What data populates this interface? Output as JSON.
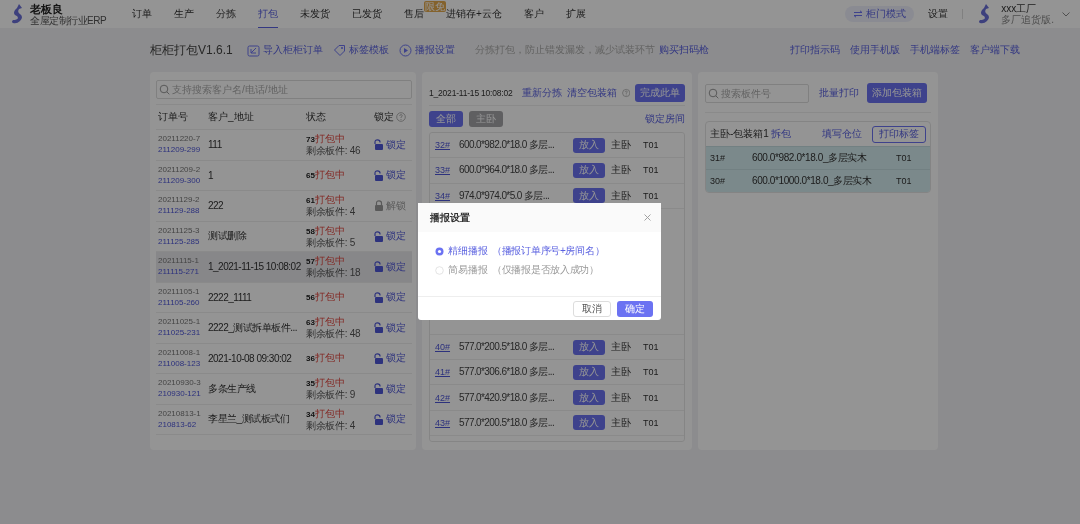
{
  "nav": {
    "logo": {
      "name": "老板良",
      "tagline": "全屋定制行业ERP"
    },
    "items": [
      {
        "label": "订单",
        "selected": false
      },
      {
        "label": "生产",
        "selected": false
      },
      {
        "label": "分拣",
        "selected": false
      },
      {
        "label": "打包",
        "selected": true
      },
      {
        "label": "未发货",
        "selected": false
      },
      {
        "label": "已发货",
        "selected": false
      },
      {
        "label": "售后",
        "selected": false,
        "badge": "限免"
      },
      {
        "label": "进销存+云仓",
        "selected": false
      },
      {
        "label": "客户",
        "selected": false
      },
      {
        "label": "扩展",
        "selected": false
      }
    ],
    "mode_button": "柜门模式",
    "settings": "设置",
    "user": {
      "name": "xxx工厂",
      "plan": "多厂追货版."
    }
  },
  "toolbar": {
    "title": "柜柜打包V1.6.1",
    "actions": [
      {
        "label": "导入柜柜订单",
        "kind": "import"
      },
      {
        "label": "标签模板",
        "kind": "tag"
      },
      {
        "label": "播报设置",
        "kind": "play"
      }
    ],
    "hint": "分拣打包，防止错发漏发，减少试装环节",
    "hint_link": "购买扫码枪",
    "links": [
      "打印指示码",
      "使用手机版",
      "手机端标签",
      "客户端下载"
    ]
  },
  "orders": {
    "search_placeholder": "支持搜索客户名/电话/地址",
    "columns": [
      {
        "label": "订单号",
        "help": false
      },
      {
        "label": "客户_地址",
        "help": false
      },
      {
        "label": "状态",
        "help": false
      },
      {
        "label": "锁定",
        "help": true
      }
    ],
    "rows": [
      {
        "order_no": "20211220-7",
        "batch_no": "211209-299",
        "customer": "111",
        "count": "73",
        "status": "打包中",
        "remaining": "剩余板件: 46",
        "lock_label": "锁定",
        "locked": false,
        "selected": false
      },
      {
        "order_no": "20211209-2",
        "batch_no": "211209-300",
        "customer": "1",
        "count": "65",
        "status": "打包中",
        "lock_label": "锁定",
        "locked": false,
        "selected": false
      },
      {
        "order_no": "20211129-2",
        "batch_no": "211129-288",
        "customer": "222",
        "count": "61",
        "status": "打包中",
        "remaining": "剩余板件: 4",
        "lock_label": "解锁",
        "locked": true,
        "selected": false
      },
      {
        "order_no": "20211125-3",
        "batch_no": "211125-285",
        "customer": "测试删除",
        "count": "58",
        "status": "打包中",
        "remaining": "剩余板件: 5",
        "lock_label": "锁定",
        "locked": false,
        "selected": false
      },
      {
        "order_no": "20211115-1",
        "batch_no": "211115-271",
        "customer": "1_2021-11-15 10:08:02",
        "count": "57",
        "status": "打包中",
        "remaining": "剩余板件: 18",
        "lock_label": "锁定",
        "locked": false,
        "selected": true
      },
      {
        "order_no": "20211105-1",
        "batch_no": "211105-260",
        "customer": "2222_1111",
        "count": "56",
        "status": "打包中",
        "lock_label": "锁定",
        "locked": false,
        "selected": false
      },
      {
        "order_no": "20211025-1",
        "batch_no": "211025-231",
        "customer": "2222_测试拆单板件...",
        "count": "63",
        "status": "打包中",
        "remaining": "剩余板件: 48",
        "lock_label": "锁定",
        "locked": false,
        "selected": false
      },
      {
        "order_no": "20211008-1",
        "batch_no": "211008-123",
        "customer": "2021-10-08 09:30:02",
        "count": "36",
        "status": "打包中",
        "lock_label": "锁定",
        "locked": false,
        "selected": false
      },
      {
        "order_no": "20210930-3",
        "batch_no": "210930-121",
        "customer": "多条生产线",
        "count": "35",
        "status": "打包中",
        "remaining": "剩余板件: 9",
        "lock_label": "锁定",
        "locked": false,
        "selected": false
      },
      {
        "order_no": "20210813-1",
        "batch_no": "210813-62",
        "customer": "李星兰_测试板式们",
        "count": "34",
        "status": "打包中",
        "remaining": "剩余板件: 4",
        "lock_label": "锁定",
        "locked": false,
        "selected": false
      }
    ]
  },
  "packing": {
    "title": "1_2021-11-15 10:08:02",
    "links": [
      {
        "label": "重新分拣",
        "help": false
      },
      {
        "label": "清空包装箱",
        "help": true
      }
    ],
    "complete_button": "完成此单",
    "filters": [
      {
        "label": "全部",
        "selected": true
      },
      {
        "label": "主卧",
        "selected": false
      }
    ],
    "lock_room": "锁定房间",
    "rows_top": [
      {
        "no": "32#",
        "spec": "600.0*982.0*18.0 多层...",
        "button": "放入",
        "room": "主卧",
        "code": "T01"
      },
      {
        "no": "33#",
        "spec": "600.0*964.0*18.0 多层...",
        "button": "放入",
        "room": "主卧",
        "code": "T01"
      },
      {
        "no": "34#",
        "spec": "974.0*974.0*5.0 多层...",
        "button": "放入",
        "room": "主卧",
        "code": "T01"
      }
    ],
    "rows_bottom": [
      {
        "no": "40#",
        "spec": "577.0*200.5*18.0 多层...",
        "button": "放入",
        "room": "主卧",
        "code": "T01"
      },
      {
        "no": "41#",
        "spec": "577.0*306.6*18.0 多层...",
        "button": "放入",
        "room": "主卧",
        "code": "T01"
      },
      {
        "no": "42#",
        "spec": "577.0*420.9*18.0 多层...",
        "button": "放入",
        "room": "主卧",
        "code": "T01"
      },
      {
        "no": "43#",
        "spec": "577.0*200.5*18.0 多层...",
        "button": "放入",
        "room": "主卧",
        "code": "T01"
      }
    ]
  },
  "boxes": {
    "search_placeholder": "搜索板件号",
    "batch_print": "批量打印",
    "add_box": "添加包装箱",
    "box": {
      "title": "主卧-包装箱1",
      "unpack": "拆包",
      "fill_location": "填写仓位",
      "print_label": "打印标签",
      "rows": [
        {
          "no": "31#",
          "spec": "600.0*982.0*18.0_多层实木",
          "code": "T01"
        },
        {
          "no": "30#",
          "spec": "600.0*1000.0*18.0_多层实木",
          "code": "T01"
        }
      ]
    }
  },
  "modal": {
    "title": "播报设置",
    "options": [
      {
        "label": "精细播报",
        "note": "（播报订单序号+房间名）",
        "selected": true
      },
      {
        "label": "简易播报",
        "note": "（仅播报是否放入成功）",
        "selected": false
      }
    ],
    "buttons": [
      {
        "label": "取消",
        "kind": "secondary"
      },
      {
        "label": "确定",
        "kind": "primary"
      }
    ]
  }
}
